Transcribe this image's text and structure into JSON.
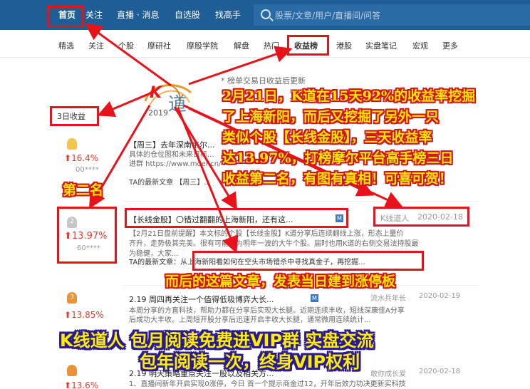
{
  "nav": {
    "items": [
      "首页",
      "关注",
      "直播 · 消息",
      "自选股",
      "找高手"
    ],
    "search_placeholder": "股票/文章/用户/直播间/问答"
  },
  "subnav": {
    "tabs": [
      "精选",
      "关注",
      "个股",
      "摩研社",
      "摩股学院",
      "解盘",
      "热门",
      "收益榜",
      "港股",
      "实盘笔记",
      "宏观",
      "更多"
    ],
    "active": "收益榜"
  },
  "board": {
    "note": "* 榜单交易日收益后更新",
    "period": "3日收益"
  },
  "logo": {
    "letter": "K",
    "text": "道",
    "year": "2019"
  },
  "rows": [
    {
      "rank": "",
      "pct": "16.4%",
      "user": "00****",
      "title": "【周三】去年深南韦尔...",
      "lines": [
        "具体的仓位图和未来日标...",
        "进群 https://www.moer.cn/front/users/profile/..."
      ],
      "latest": "TA的最新文章 【周三】..."
    },
    {
      "rank": "2",
      "pct": "13.97%",
      "user": "60****",
      "title": "【长线金股】〇错过翻翻的上海新阳，还有这...",
      "author": "K线道人",
      "date": "2020-02-18",
      "lines": [
        "【2月21日盘前提醒】本文标的个股【长线金股】K道分享后连续翻线上涨，形态上量价",
        "齐升，走势极其完美。很有可能成为明年一波的大牛个股。届时也用K道的右侧交易法持股最",
        "为稳健，大家..."
      ],
      "latest": "TA的最新文章：从上海新阳看如何在空头市场错杀中寻找真金子，再挖掘..."
    },
    {
      "rank": "3",
      "pct": "13.85%",
      "user": "",
      "title": "2.19 周四再关注一个值得低吸博弈大长...",
      "author": "流水兵年长",
      "date": "2020-02-19",
      "lines": [
        "本周分享的方直科技，帮助力都在分享后实现大长腿。近期连续丰收，短线深康佳A分享",
        "后成功大丰收。上周短开股分享后迅速开启丰收大长腿，通常微用连续统计..."
      ],
      "latest": ""
    },
    {
      "rank": "",
      "pct": "13.6%",
      "user": "",
      "title": "2.19 明天策略重点关注一股以及相关方...",
      "author": "敢你成长爱",
      "date": "2020-02-18",
      "lines": [
        "1、直播间新年开启实现0涨停，今日 首一个提示商金过12，开年后效力功决更新实科技"
      ],
      "latest": ""
    }
  ],
  "captions": {
    "main": [
      "2月21日，K道在15天92%的收益率挖掘",
      "了上海新阳，而后又挖掘了另外一只",
      "类似个股【长线金股】，三天收益率",
      "达13.97%，打榜摩尔平台高手榜三日",
      "收益第二名，有图有真相！可喜可贺！"
    ],
    "second": "第二名",
    "article": "而后的这篇文章，发表当日建到涨停板",
    "promo": [
      "K线道人 包月阅读免费进VIP群 实盘交流",
      "包年阅读一次，终身VIP权利"
    ]
  },
  "colors": {
    "nav_bg": "#1f5d96",
    "highlight": "#e8131a",
    "caption_fill": "#ffe600",
    "caption_stroke": "#d1141a",
    "promo_stroke": "#2a1a90",
    "gain": "#e83b2d"
  }
}
